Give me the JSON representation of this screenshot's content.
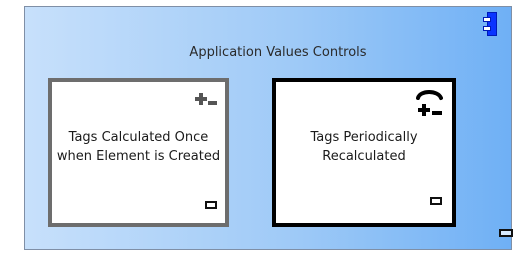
{
  "diagram": {
    "component": {
      "title": "Application Values Controls"
    },
    "elements": [
      {
        "label": "Tags Calculated Once when Element is Created",
        "icon": "plus-minus-icon"
      },
      {
        "label": "Tags Periodically Recalculated",
        "icon": "refresh-plus-minus-icon"
      }
    ],
    "colors": {
      "component_fill_light": "#c7e0fb",
      "component_fill_dark": "#6fb0f5",
      "component_icon": "#0a34ff",
      "element_border_grey": "#6d6d6d",
      "element_border_black": "#000000"
    }
  }
}
